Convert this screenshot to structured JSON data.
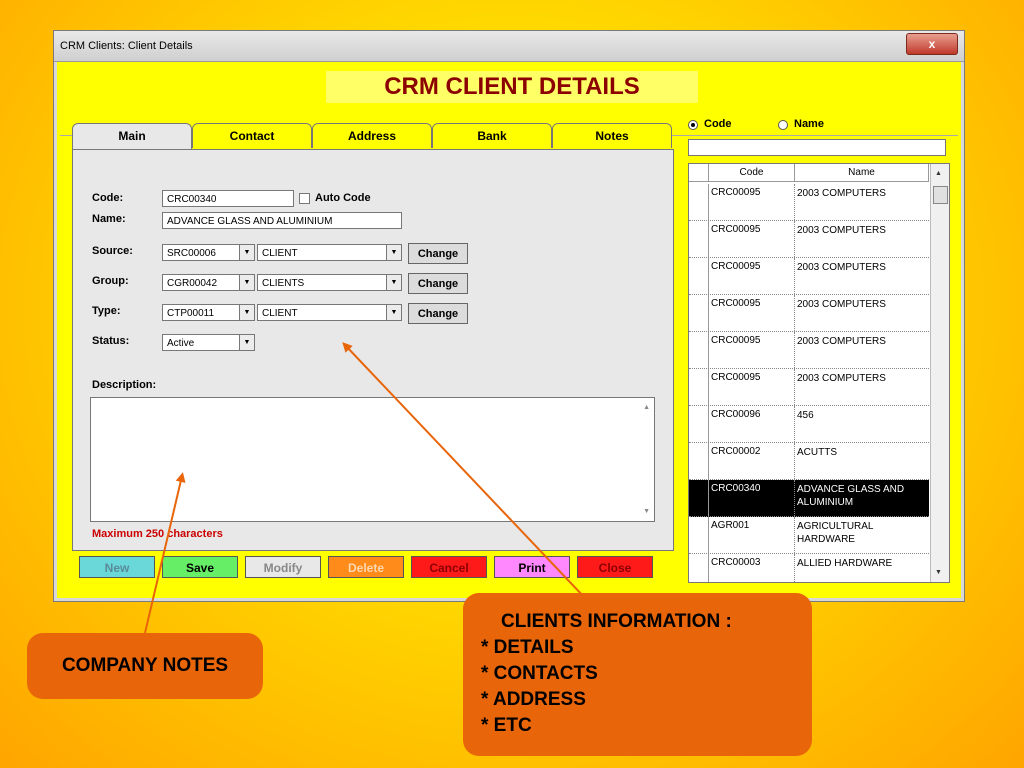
{
  "window": {
    "title": "CRM Clients: Client Details",
    "close_label": "x"
  },
  "header": {
    "title": "CRM CLIENT DETAILS"
  },
  "tabs": [
    {
      "label": "Main"
    },
    {
      "label": "Contact"
    },
    {
      "label": "Address"
    },
    {
      "label": "Bank"
    },
    {
      "label": "Notes"
    }
  ],
  "form": {
    "code_label": "Code:",
    "code_value": "CRC00340",
    "auto_code_label": "Auto Code",
    "name_label": "Name:",
    "name_value": "ADVANCE GLASS AND ALUMINIUM",
    "source_label": "Source:",
    "source_code": "SRC00006",
    "source_name": "CLIENT",
    "group_label": "Group:",
    "group_code": "CGR00042",
    "group_name": "CLIENTS",
    "type_label": "Type:",
    "type_code": "CTP00011",
    "type_name": "CLIENT",
    "status_label": "Status:",
    "status_value": "Active",
    "change_label": "Change",
    "description_label": "Description:",
    "max_note": "Maximum 250 characters"
  },
  "actions": {
    "new": "New",
    "save": "Save",
    "modify": "Modify",
    "delete": "Delete",
    "cancel": "Cancel",
    "print": "Print",
    "close": "Close"
  },
  "search": {
    "radio_code": "Code",
    "radio_name": "Name",
    "selected": "Code"
  },
  "grid": {
    "headers": [
      "Code",
      "Name"
    ],
    "rows": [
      {
        "code": "CRC00095",
        "name": "2003 COMPUTERS"
      },
      {
        "code": "CRC00095",
        "name": "2003 COMPUTERS"
      },
      {
        "code": "CRC00095",
        "name": "2003 COMPUTERS"
      },
      {
        "code": "CRC00095",
        "name": "2003 COMPUTERS"
      },
      {
        "code": "CRC00095",
        "name": "2003 COMPUTERS"
      },
      {
        "code": "CRC00095",
        "name": "2003 COMPUTERS"
      },
      {
        "code": "CRC00096",
        "name": "456"
      },
      {
        "code": "CRC00002",
        "name": "ACUTTS"
      },
      {
        "code": "CRC00340",
        "name": "ADVANCE GLASS AND ALUMINIUM"
      },
      {
        "code": "AGR001",
        "name": "AGRICULTURAL HARDWARE"
      },
      {
        "code": "CRC00003",
        "name": "ALLIED HARDWARE"
      }
    ],
    "selected_index": 8
  },
  "callouts": {
    "notes": "COMPANY NOTES",
    "info_title": "CLIENTS INFORMATION :",
    "info_lines": [
      "* DETAILS",
      "* CONTACTS",
      "* ADDRESS",
      "* ETC"
    ]
  },
  "colors": {
    "window_bg": "#ffff00",
    "header_text": "#8b0000",
    "callout_bg": "#e8650a",
    "arrow": "#e8650a",
    "new_bg": "#6ad8d8",
    "save_bg": "#66ee66",
    "modify_bg": "#e8e8e8",
    "delete_bg": "#ff8c1a",
    "cancel_bg": "#ff1a1a",
    "print_bg": "#ff88ff",
    "close_bg": "#ff1a1a"
  }
}
